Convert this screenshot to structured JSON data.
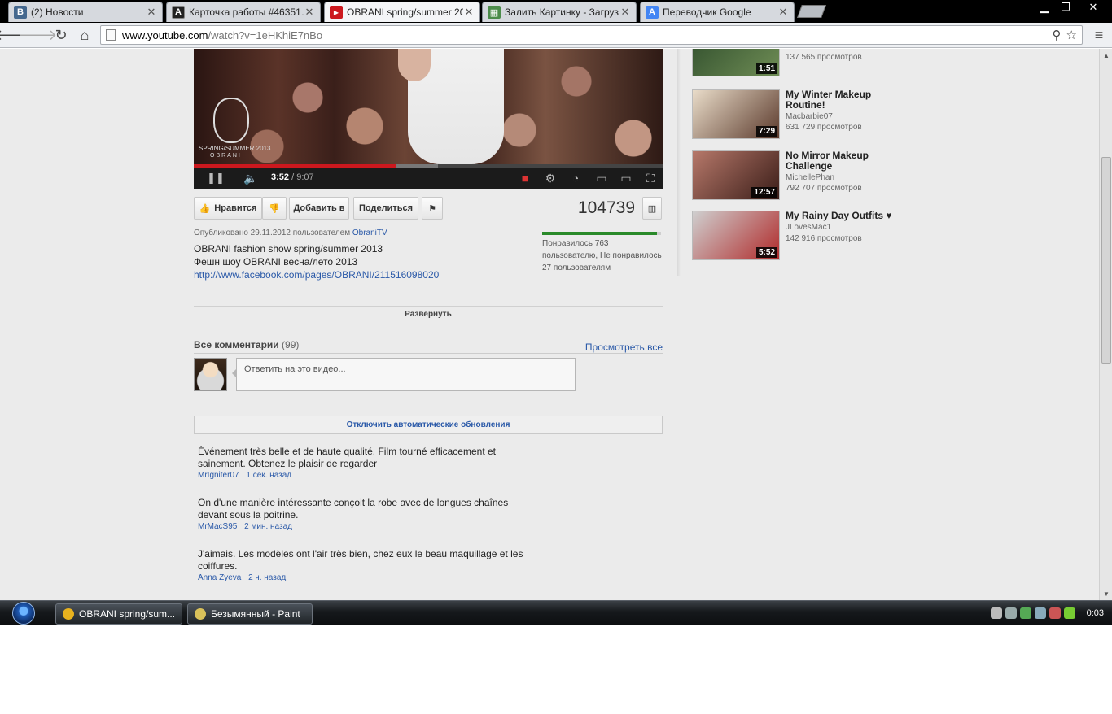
{
  "browser": {
    "tabs": [
      {
        "title": "(2) Новости",
        "favicon_letter": "В",
        "favicon_color": "#45688e"
      },
      {
        "title": "Карточка работы #46351…",
        "favicon_letter": "A",
        "favicon_color": "#222222"
      },
      {
        "title": "OBRANI spring/summer 20…",
        "favicon_letter": "▶",
        "favicon_color": "#cc181e"
      },
      {
        "title": "Залить Картинку - Загрузи…",
        "favicon_letter": "▦",
        "favicon_color": "#4c8c4a"
      },
      {
        "title": "Переводчик Google",
        "favicon_letter": "A",
        "favicon_color": "#4285f4"
      }
    ],
    "url_host": "www.youtube.com",
    "url_path": "/watch?v=1eHKhiE7nBo"
  },
  "player": {
    "time_current": "3:52",
    "time_total": "/ 9:07",
    "progress_played": 0.43,
    "progress_buffered": 0.52,
    "overlay_line1": "SPRING/SUMMER 2013",
    "overlay_line2": "OBRANI"
  },
  "actions": {
    "like_label": "Нравится",
    "add_label": "Добавить в",
    "share_label": "Поделиться",
    "views": "104739",
    "likes_ratio": 0.966,
    "likes_text": "Понравилось 763 пользователю, Не понравилось 27 пользователям"
  },
  "info": {
    "published_prefix": "Опубликовано 29.11.2012 пользователем",
    "channel": "ObraniTV",
    "desc_line1": "OBRANI fashion show spring/summer 2013",
    "desc_line2": "Фешн шоу OBRANI весна/лето 2013",
    "desc_link": "http://www.facebook.com/pages/OBRANI/211516098020",
    "expand_label": "Развернуть"
  },
  "comments": {
    "title": "Все комментарии",
    "count": "(99)",
    "view_all": "Просмотреть все",
    "reply_placeholder": "Ответить на это видео...",
    "auto_update_label": "Отключить автоматические обновления",
    "items": [
      {
        "text": "Événement très belle et de haute qualité. Film tourné efficacement et sainement. Obtenez le plaisir de regarder",
        "author": "MrIgniter07",
        "time": "1 сек. назад"
      },
      {
        "text": "On d'une manière intéressante conçoit la robe avec de longues chaînes devant sous la poitrine.",
        "author": "MrMacS95",
        "time": "2 мин. назад"
      },
      {
        "text": "J'aimais. Les modèles ont l'air très bien, chez eux le beau maquillage et les coiffures.",
        "author": "Anna Zyeva",
        "time": "2 ч. назад"
      }
    ]
  },
  "related": [
    {
      "title": "",
      "author": "",
      "views": "137 565 просмотров",
      "duration": "1:51",
      "thumb_colors": [
        "#2f4d2c",
        "#6f8d55"
      ]
    },
    {
      "title": "My Winter Makeup Routine!",
      "author": "Macbarbie07",
      "views": "631 729 просмотров",
      "duration": "7:29",
      "thumb_colors": [
        "#e9dcc9",
        "#5b3a2c"
      ]
    },
    {
      "title": "No Mirror Makeup Challenge",
      "author": "MichellePhan",
      "views": "792 707 просмотров",
      "duration": "12:57",
      "thumb_colors": [
        "#b6786a",
        "#3a1d18"
      ]
    },
    {
      "title": "My Rainy Day Outfits ♥",
      "author": "JLovesMac1",
      "views": "142 916 просмотров",
      "duration": "5:52",
      "thumb_colors": [
        "#cfcfcf",
        "#b02a2a"
      ]
    }
  ],
  "taskbar": {
    "items": [
      {
        "label": "OBRANI spring/sum...",
        "icon_color": "#e8b21e"
      },
      {
        "label": "Безымянный - Paint",
        "icon_color": "#d9c15a"
      }
    ],
    "clock": "0:03"
  }
}
